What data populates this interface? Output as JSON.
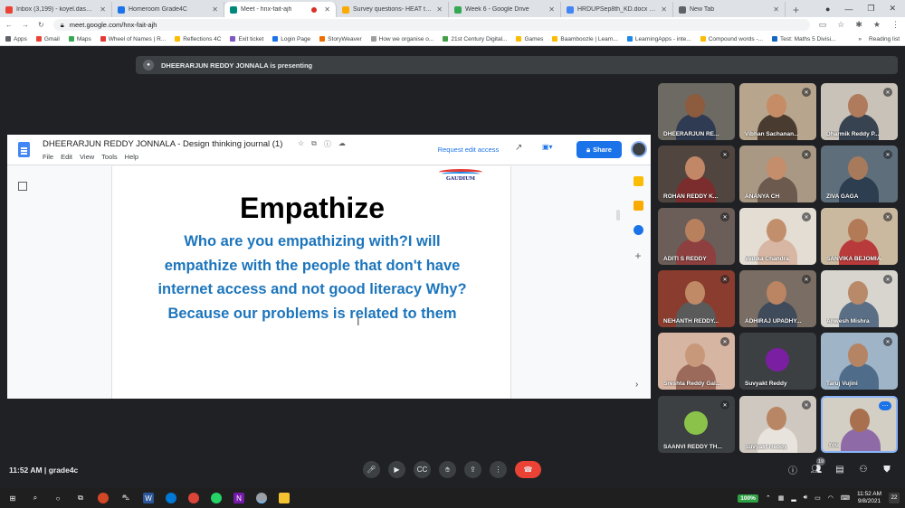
{
  "browser": {
    "tabs": [
      {
        "label": "Inbox (3,199) - koyel.das@theg...",
        "color": "#ea4335",
        "active": false
      },
      {
        "label": "Homeroom Grade4C",
        "color": "#1a73e8",
        "active": false
      },
      {
        "label": "Meet - hnx-fait-ajh",
        "color": "#00897b",
        "active": true
      },
      {
        "label": "Survey questions- HEAT team -",
        "color": "#f9ab00",
        "active": false
      },
      {
        "label": "Week 6 - Google Drive",
        "color": "#34a853",
        "active": false
      },
      {
        "label": "HRDUPSep8th_KD.docx - Googl",
        "color": "#4285f4",
        "active": false
      },
      {
        "label": "New Tab",
        "color": "#5f6368",
        "active": false
      }
    ],
    "url": "meet.google.com/hnx-fait-ajh",
    "bookmarks": [
      {
        "label": "Apps",
        "color": "#5f6368"
      },
      {
        "label": "Gmail",
        "color": "#ea4335"
      },
      {
        "label": "Maps",
        "color": "#34a853"
      },
      {
        "label": "Wheel of Names | R...",
        "color": "#e53935"
      },
      {
        "label": "Reflections 4C",
        "color": "#fbbc04"
      },
      {
        "label": "Exit ticket",
        "color": "#7e57c2"
      },
      {
        "label": "Login Page",
        "color": "#1a73e8"
      },
      {
        "label": "StoryWeaver",
        "color": "#ef6c00"
      },
      {
        "label": "How we organise o...",
        "color": "#9e9e9e"
      },
      {
        "label": "21st Century Digital...",
        "color": "#43a047"
      },
      {
        "label": "Games",
        "color": "#fbbc04"
      },
      {
        "label": "Baamboozle | Learn...",
        "color": "#fbbc04"
      },
      {
        "label": "LearningApps - inte...",
        "color": "#1e88e5"
      },
      {
        "label": "Compound words -...",
        "color": "#fbbc04"
      },
      {
        "label": "Test: Maths 5 Divisi...",
        "color": "#1565c0"
      }
    ],
    "bookmarks_more": "»",
    "reading_list": "Reading list"
  },
  "meet": {
    "presenting_banner": "DHEERARJUN REDDY JONNALA is presenting",
    "time": "11:52 AM",
    "separator": "|",
    "meeting_name": "grade4c",
    "participant_count": "19",
    "participants": [
      {
        "name": "DHEERARJUN RE...",
        "bg": "#6d6a63",
        "skin": "#8d5b3e",
        "shirt": "#2f3b52",
        "muted": false
      },
      {
        "name": "Vibhan Sachanan...",
        "bg": "#b8a58d",
        "skin": "#c58c65",
        "shirt": "#4a3b31",
        "muted": true
      },
      {
        "name": "Dharmik Reddy P...",
        "bg": "#c9c2b9",
        "skin": "#b07b5c",
        "shirt": "#374351",
        "muted": true
      },
      {
        "name": "ROHAN REDDY K...",
        "bg": "#51463f",
        "skin": "#c28766",
        "shirt": "#7b2d2d",
        "muted": true
      },
      {
        "name": "ANANYA CH",
        "bg": "#a89884",
        "skin": "#c48e6c",
        "shirt": "#6c5a4e",
        "muted": true
      },
      {
        "name": "ZIVA GAGA",
        "bg": "#5e6f7b",
        "skin": "#a77a5c",
        "shirt": "#2c3e50",
        "muted": true
      },
      {
        "name": "ADITI S REDDY",
        "bg": "#6b5d57",
        "skin": "#b9805e",
        "shirt": "#8e3f3f",
        "muted": true
      },
      {
        "name": "Vedika Chandra",
        "bg": "#e3ddd3",
        "skin": "#c28f6d",
        "shirt": "#d7b7a3",
        "muted": true
      },
      {
        "name": "SANVIKA BEJOMIA",
        "bg": "#cbb99f",
        "skin": "#b37a57",
        "shirt": "#b93a3a",
        "muted": true
      },
      {
        "name": "NEHANTH REDDY...",
        "bg": "#8a3d2e",
        "skin": "#c08a66",
        "shirt": "#5a5a5a",
        "muted": true
      },
      {
        "name": "ADHIRAJ UPADHY...",
        "bg": "#7a6e64",
        "skin": "#bb8462",
        "shirt": "#3f4a5a",
        "muted": true
      },
      {
        "name": "Anwesh Mishra",
        "bg": "#d8d5cf",
        "skin": "#b98a6a",
        "shirt": "#5a6f86",
        "muted": true
      },
      {
        "name": "Sreshta Reddy Gal...",
        "bg": "#d7b5a3",
        "skin": "#c8987a",
        "shirt": "#9b6a5a",
        "muted": true
      },
      {
        "name": "Suvyakt Reddy",
        "bg": "#3c4043",
        "skin": "#7b1fa2",
        "shirt": "#3c4043",
        "muted": false,
        "avatar": true
      },
      {
        "name": "Taruj Vujini",
        "bg": "#9fb4c7",
        "skin": "#b58464",
        "shirt": "#4f6d8a",
        "muted": true
      },
      {
        "name": "SAANVI REDDY TH...",
        "bg": "#3c4043",
        "skin": "#8bc34a",
        "shirt": "#3c4043",
        "muted": true,
        "avatar": true
      },
      {
        "name": "Suvyakt Reddy",
        "bg": "#cfc8c0",
        "skin": "#b88664",
        "shirt": "#e8e3dd",
        "muted": true
      },
      {
        "name": "You",
        "bg": "#d4cfc5",
        "skin": "#a8704e",
        "shirt": "#8e6aa6",
        "muted": false,
        "you": true
      }
    ]
  },
  "document": {
    "title": "DHEERARJUN REDDY JONNALA - Design thinking journal (1)",
    "menu": [
      "File",
      "Edit",
      "View",
      "Tools",
      "Help"
    ],
    "request_edit": "Request edit access",
    "share": "Share",
    "school_logo": "GAUDIUM",
    "heading": "Empathize",
    "body": "Who are you empathizing with?I will empathize with the people that don't have internet access and not good literacy Why?Because our problems is related to them"
  },
  "taskbar": {
    "battery": "100%",
    "time": "11:52 AM",
    "date": "9/8/2021",
    "notifications": "22"
  }
}
